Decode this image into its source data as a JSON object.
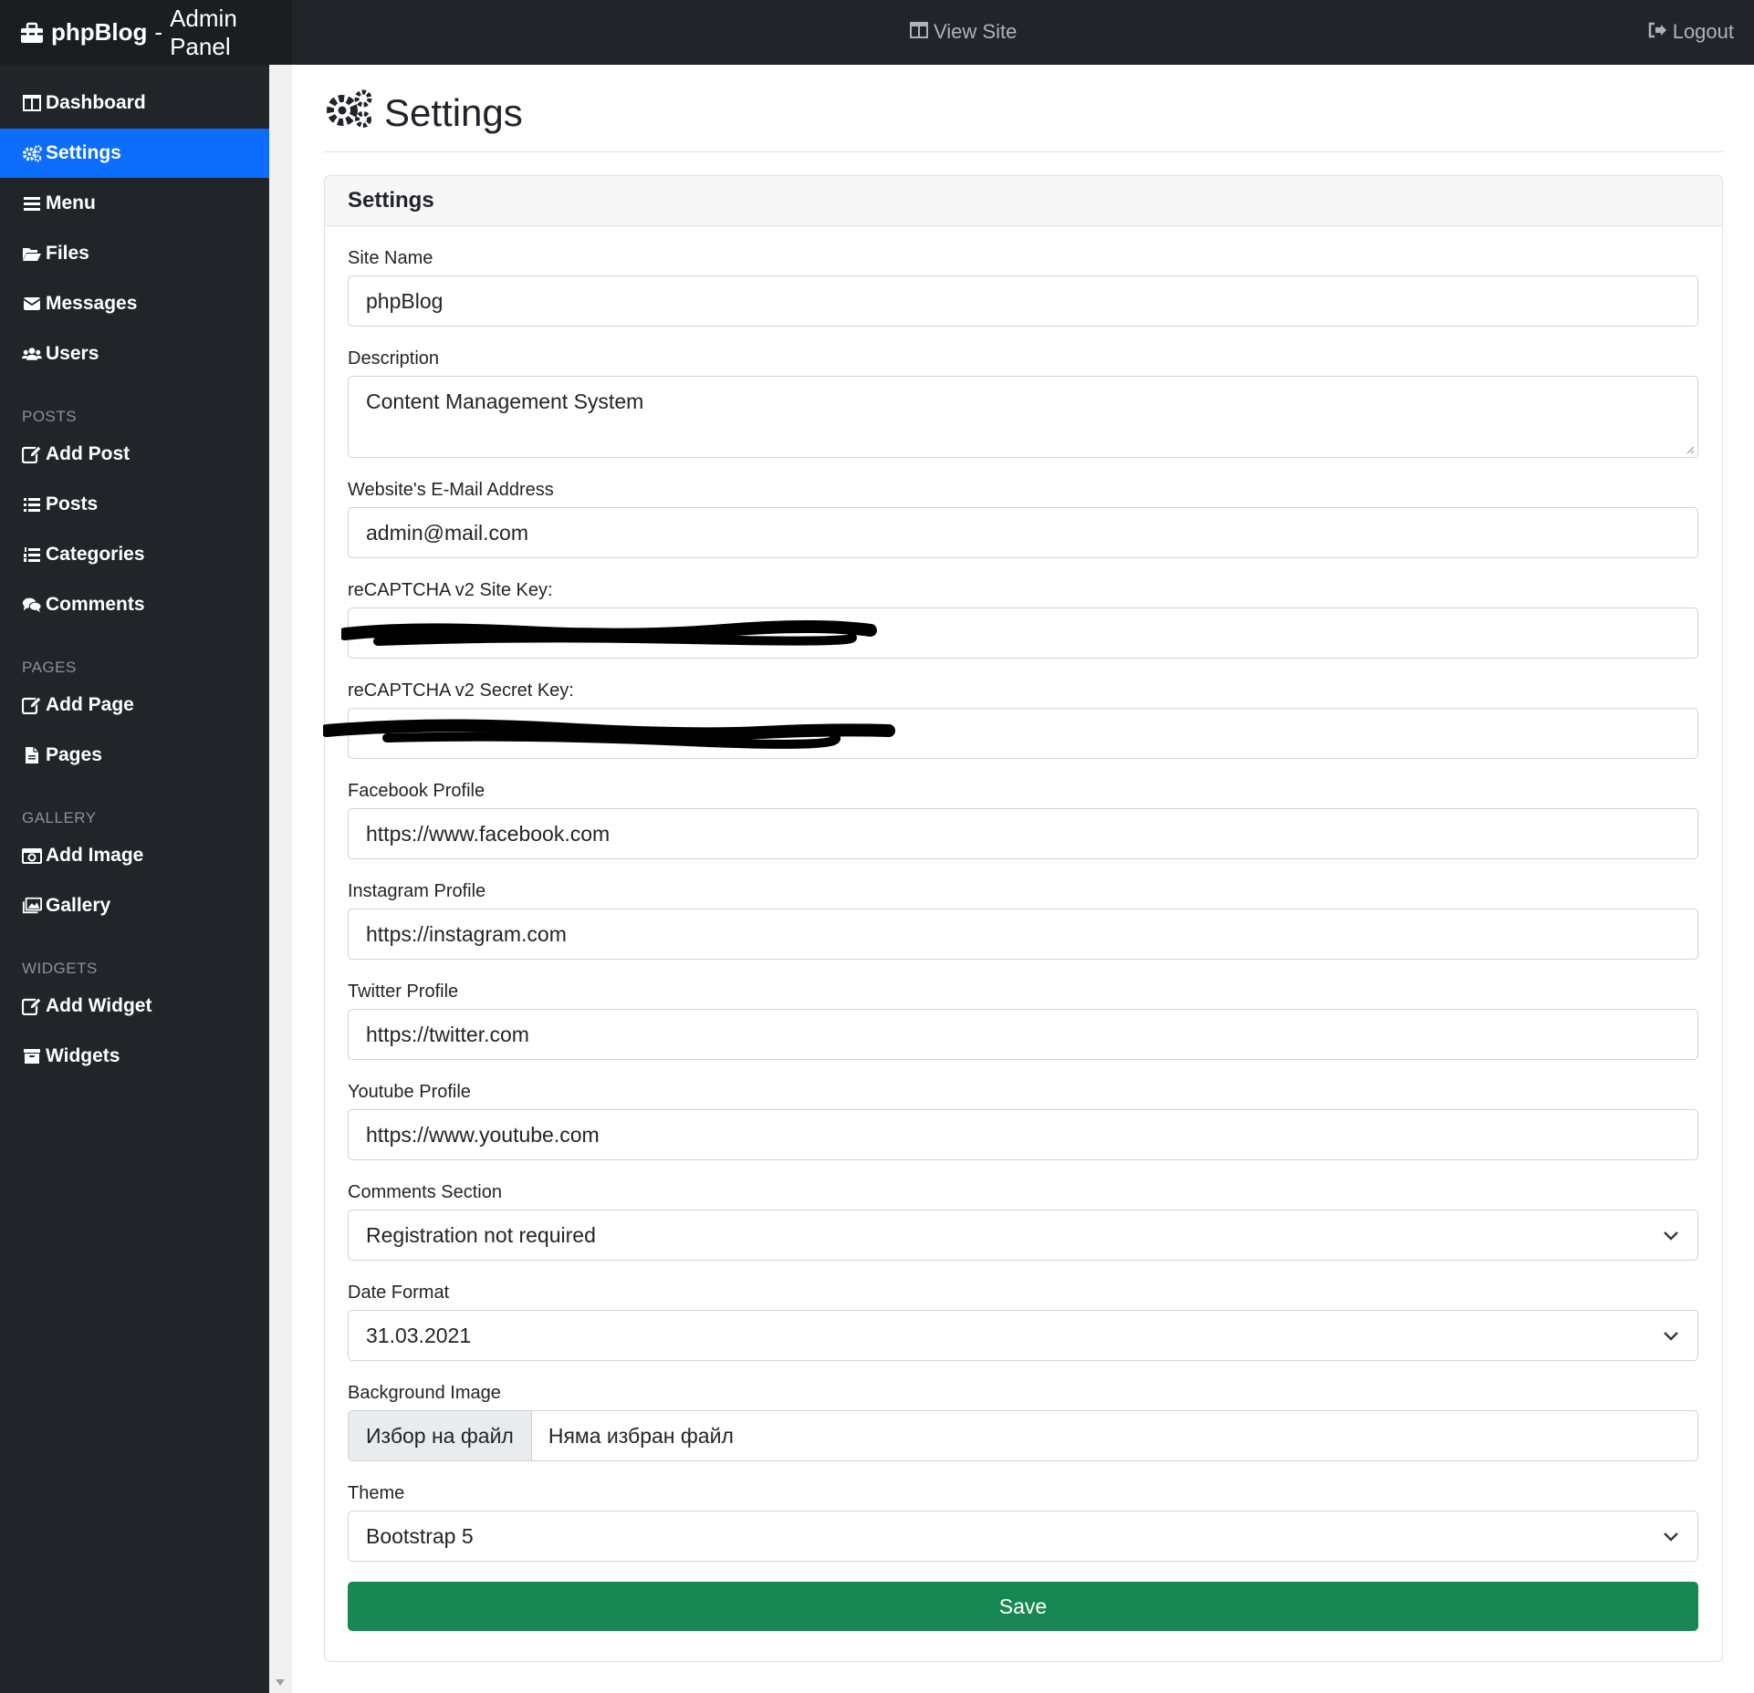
{
  "brand": {
    "name": "phpBlog",
    "separator": "-",
    "subtitle": "Admin Panel",
    "icon": "toolbox-icon"
  },
  "topbar": {
    "view_site": {
      "label": "View Site",
      "icon": "window-icon"
    },
    "logout": {
      "label": "Logout",
      "icon": "sign-out-icon"
    }
  },
  "sidebar": {
    "items": [
      {
        "label": "Dashboard",
        "icon": "columns-icon",
        "active": false
      },
      {
        "label": "Settings",
        "icon": "cogs-icon",
        "active": true
      },
      {
        "label": "Menu",
        "icon": "bars-icon",
        "active": false
      },
      {
        "label": "Files",
        "icon": "folder-open-icon",
        "active": false
      },
      {
        "label": "Messages",
        "icon": "envelope-icon",
        "active": false
      },
      {
        "label": "Users",
        "icon": "users-icon",
        "active": false
      }
    ],
    "sections": [
      {
        "heading": "POSTS",
        "items": [
          {
            "label": "Add Post",
            "icon": "edit-icon"
          },
          {
            "label": "Posts",
            "icon": "list-icon"
          },
          {
            "label": "Categories",
            "icon": "list-ol-icon"
          },
          {
            "label": "Comments",
            "icon": "comments-icon"
          }
        ]
      },
      {
        "heading": "PAGES",
        "items": [
          {
            "label": "Add Page",
            "icon": "edit-icon"
          },
          {
            "label": "Pages",
            "icon": "file-icon"
          }
        ]
      },
      {
        "heading": "GALLERY",
        "items": [
          {
            "label": "Add Image",
            "icon": "camera-icon"
          },
          {
            "label": "Gallery",
            "icon": "images-icon"
          }
        ]
      },
      {
        "heading": "WIDGETS",
        "items": [
          {
            "label": "Add Widget",
            "icon": "edit-icon"
          },
          {
            "label": "Widgets",
            "icon": "archive-icon"
          }
        ]
      }
    ]
  },
  "page": {
    "title": "Settings",
    "icon": "cogs-icon"
  },
  "form": {
    "card_title": "Settings",
    "site_name": {
      "label": "Site Name",
      "value": "phpBlog"
    },
    "description": {
      "label": "Description",
      "value": "Content Management System"
    },
    "email": {
      "label": "Website's E-Mail Address",
      "value": "admin@mail.com"
    },
    "recaptcha_site": {
      "label": "reCAPTCHA v2 Site Key:",
      "value": ""
    },
    "recaptcha_secret": {
      "label": "reCAPTCHA v2 Secret Key:",
      "value": ""
    },
    "facebook": {
      "label": "Facebook Profile",
      "value": "https://www.facebook.com"
    },
    "instagram": {
      "label": "Instagram Profile",
      "value": "https://instagram.com"
    },
    "twitter": {
      "label": "Twitter Profile",
      "value": "https://twitter.com"
    },
    "youtube": {
      "label": "Youtube Profile",
      "value": "https://www.youtube.com"
    },
    "comments": {
      "label": "Comments Section",
      "value": "Registration not required"
    },
    "date_format": {
      "label": "Date Format",
      "value": "31.03.2021"
    },
    "background": {
      "label": "Background Image",
      "button": "Избор на файл",
      "status": "Няма избран файл"
    },
    "theme": {
      "label": "Theme",
      "value": "Bootstrap 5"
    },
    "save_label": "Save"
  },
  "colors": {
    "sidebar_bg": "#212529",
    "active": "#0d6efd",
    "save": "#198754"
  }
}
